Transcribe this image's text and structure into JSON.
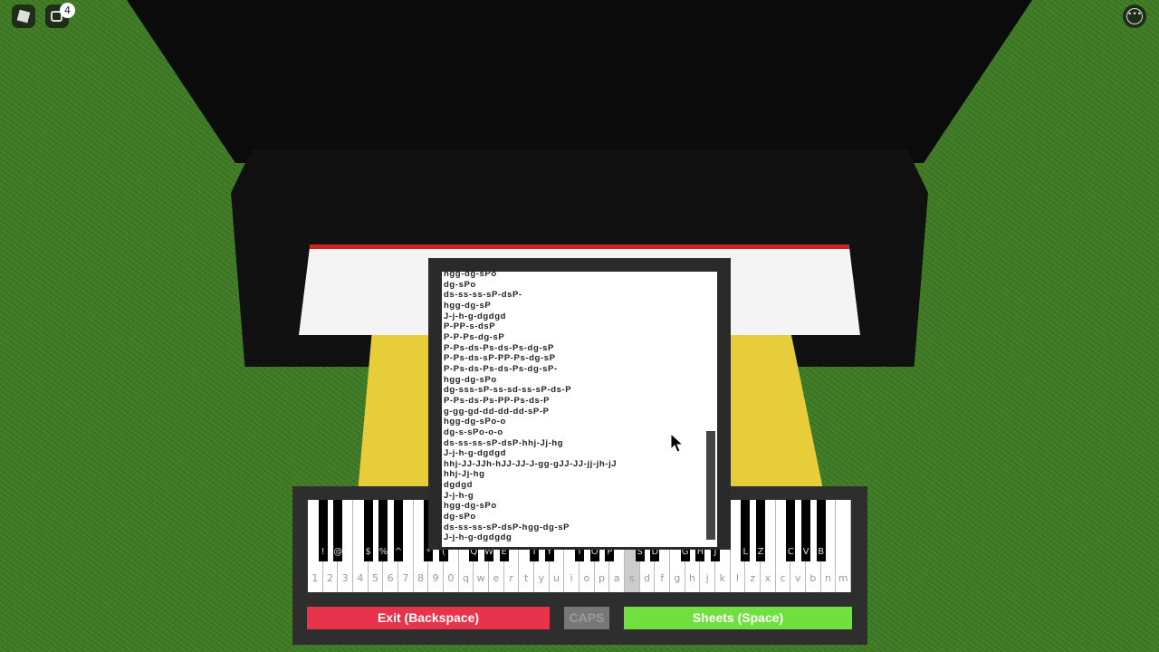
{
  "topbar": {
    "menu_icon": "roblox-logo-icon",
    "chat_icon": "chat-icon",
    "chat_badge": "4",
    "more_icon": "more-options-icon"
  },
  "sheet": {
    "lines": [
      "hgg-dg-sPo",
      "dg-sPo",
      "ds-ss-ss-sP-dsP-",
      "hgg-dg-sP",
      "J-j-h-g-dgdgd",
      "P-PP-s-dsP",
      "P-P-Ps-dg-sP",
      "P-Ps-ds-Ps-ds-Ps-dg-sP",
      "P-Ps-ds-sP-PP-Ps-dg-sP",
      "P-Ps-ds-Ps-ds-Ps-dg-sP-",
      "hgg-dg-sPo",
      "dg-sss-sP-ss-sd-ss-sP-ds-P",
      "P-Ps-ds-Ps-PP-Ps-ds-P",
      "g-gg-gd-dd-dd-dd-sP-P",
      "hgg-dg-sPo-o",
      "dg-s-sPo-o-o",
      "ds-ss-ss-sP-dsP-hhj-Jj-hg",
      "J-j-h-g-dgdgd",
      "hhj-JJ-JJh-hJJ-JJ-J-gg-gJJ-JJ-jj-jh-jJ",
      "hhj-Jj-hg",
      "dgdgd",
      "J-j-h-g",
      "hgg-dg-sPo",
      "dg-sPo",
      "ds-ss-ss-sP-dsP-hgg-dg-sP",
      "J-j-h-g-dgdgdg"
    ]
  },
  "keyboard": {
    "white_keys": [
      "1",
      "2",
      "3",
      "4",
      "5",
      "6",
      "7",
      "8",
      "9",
      "0",
      "q",
      "w",
      "e",
      "r",
      "t",
      "y",
      "u",
      "i",
      "o",
      "p",
      "a",
      "s",
      "d",
      "f",
      "g",
      "h",
      "j",
      "k",
      "l",
      "z",
      "x",
      "c",
      "v",
      "b",
      "n",
      "m"
    ],
    "pressed_key": "s",
    "black_keys": [
      "!",
      "@",
      "$",
      "%",
      "^",
      "*",
      "(",
      "Q",
      "W",
      "E",
      "T",
      "Y",
      "I",
      "O",
      "P",
      "S",
      "D",
      "G",
      "H",
      "J",
      "L",
      "Z",
      "C",
      "V",
      "B"
    ]
  },
  "buttons": {
    "exit": "Exit (Backspace)",
    "caps": "CAPS",
    "sheets": "Sheets (Space)"
  },
  "colors": {
    "exit": "#e8344a",
    "caps": "#777777",
    "sheets": "#6fe03e",
    "bench": "#e8cd3a"
  }
}
